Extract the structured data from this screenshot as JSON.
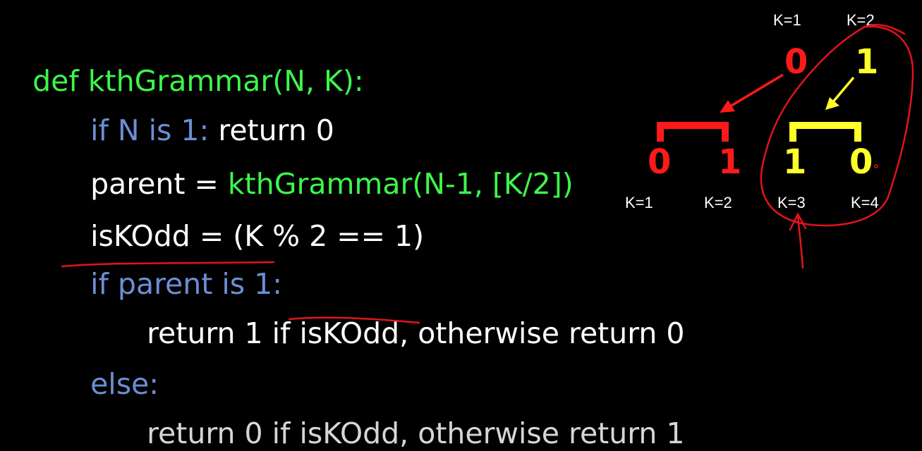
{
  "code": {
    "line1": "def kthGrammar(N, K):",
    "line2_kw": "if N is 1:",
    "line2_rest": " return 0",
    "line3_lhs": "parent = ",
    "line3_call": "kthGrammar(N-1, [K/2])",
    "line4": "isKOdd = (K % 2 == 1)",
    "line5": "if parent is 1:",
    "line6_a": "return 1 if ",
    "line6_b": "isKOdd",
    "line6_c": ", otherwise return 0",
    "line7": "else:",
    "line8": "return 0 if isKOdd, otherwise return 1"
  },
  "diagram": {
    "top_labels": [
      "K=1",
      "K=2"
    ],
    "top_values": [
      "0",
      "1"
    ],
    "bottom_values": [
      "0",
      "1",
      "1",
      "0"
    ],
    "bottom_labels": [
      "K=1",
      "K=2",
      "K=3",
      "K=4"
    ],
    "colors": {
      "red": "#ff1a1a",
      "yellow": "#ffff2a",
      "green": "#3df54a",
      "blue": "#6b8fd4"
    }
  }
}
